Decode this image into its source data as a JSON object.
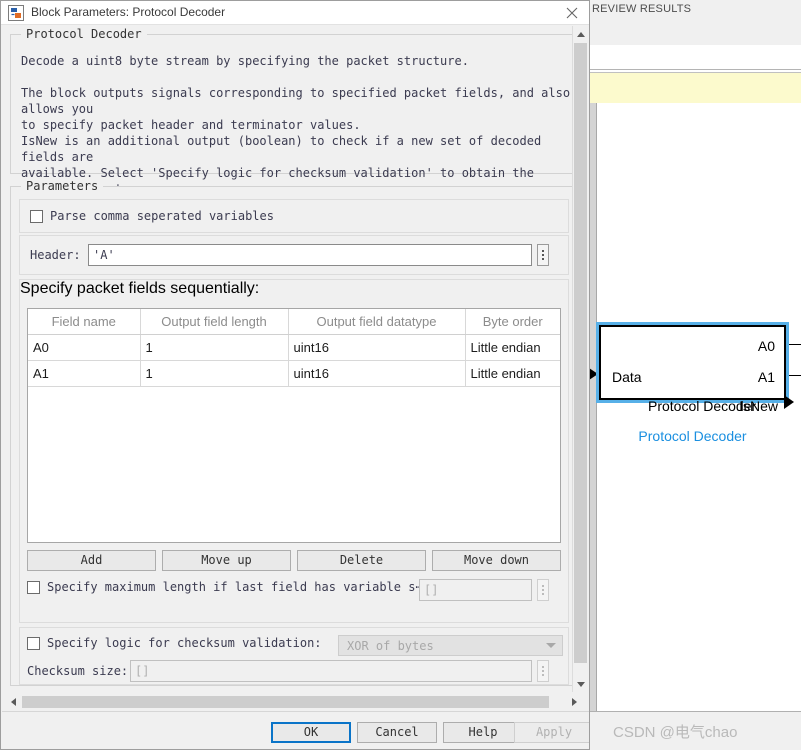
{
  "background": {
    "toolstrip_label": "REVIEW RESULTS",
    "watermark": "CSDN @电气chao"
  },
  "block": {
    "input_port_label": "Data",
    "output_ports": [
      "A0",
      "A1",
      "IsNew"
    ],
    "inner_name": "Protocol Decoder",
    "under_name": "Protocol Decoder",
    "selection_color": "#57b0e8",
    "name_color": "#1a8fe0"
  },
  "dialog": {
    "title": "Block Parameters: Protocol Decoder",
    "close_icon": "close-icon",
    "description_group": {
      "title": "Protocol Decoder",
      "paragraph1": "Decode a uint8 byte stream by specifying the packet structure.",
      "paragraph2": "The block outputs signals corresponding to specified packet fields, and also allows you\nto specify packet header and terminator values.",
      "paragraph3": "IsNew is an additional output (boolean) to check if a new set of decoded fields are\navailable. Select 'Specify logic for checksum validation' to obtain the IsValid output\n(boolean) to check if the packet is valid or not."
    },
    "parameters_group": {
      "title": "Parameters",
      "parse_csv": {
        "label": "Parse comma seperated variables",
        "checked": false
      },
      "header": {
        "label": "Header:",
        "value": "'A'",
        "more_button": "ellipsis-button"
      },
      "fields_group": {
        "title": "Specify packet fields sequentially:",
        "columns": [
          "Field name",
          "Output field length",
          "Output field datatype",
          "Byte order"
        ],
        "rows": [
          [
            "A0",
            "1",
            "uint16",
            "Little endian"
          ],
          [
            "A1",
            "1",
            "uint16",
            "Little endian"
          ]
        ],
        "buttons": [
          "Add",
          "Move up",
          "Delete",
          "Move down"
        ]
      },
      "max_length": {
        "label": "Specify maximum length if last field has variable s⋯",
        "checked": false,
        "value": "[]",
        "enabled": false
      },
      "checksum_logic": {
        "label": "Specify logic for checksum validation:",
        "checked": false,
        "dropdown_value": "XOR of bytes",
        "enabled": false
      },
      "checksum_size": {
        "label": "Checksum size:",
        "value": "[]",
        "enabled": false
      }
    },
    "footer": {
      "ok": "OK",
      "cancel": "Cancel",
      "help": "Help",
      "apply": "Apply"
    }
  }
}
